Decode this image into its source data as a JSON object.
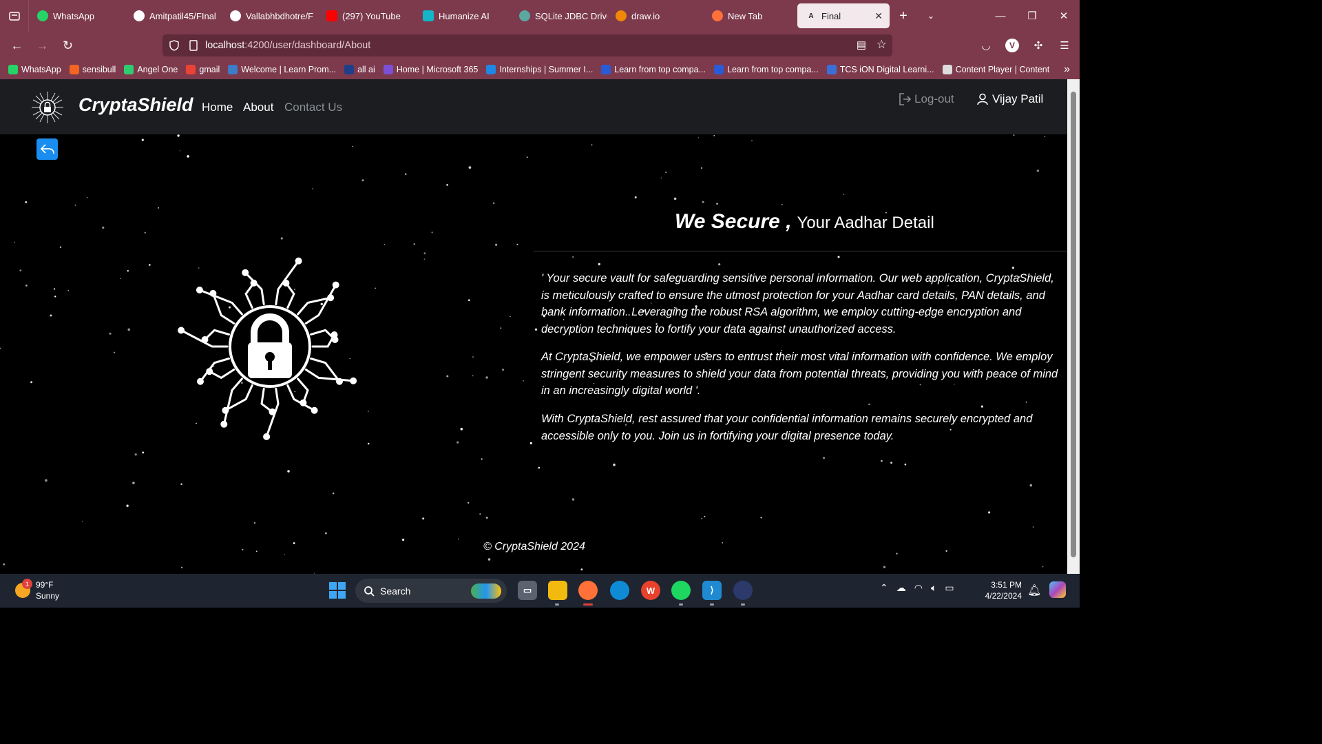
{
  "browser": {
    "tabs": [
      {
        "label": "WhatsApp",
        "icon": "whatsapp-icon",
        "color": "#25d366"
      },
      {
        "label": "Amitpatil45/FInal",
        "icon": "github-icon",
        "color": "#ffffff"
      },
      {
        "label": "Vallabhbdhotre/F",
        "icon": "github-icon",
        "color": "#ffffff"
      },
      {
        "label": "(297) YouTube",
        "icon": "youtube-icon",
        "color": "#ff0000"
      },
      {
        "label": "Humanize AI",
        "icon": "humanize-icon",
        "color": "#13b5c8"
      },
      {
        "label": "SQLite JDBC Drive",
        "icon": "sqlite-icon",
        "color": "#5ba8a0"
      },
      {
        "label": "draw.io",
        "icon": "drawio-icon",
        "color": "#f08705"
      },
      {
        "label": "New Tab",
        "icon": "firefox-icon",
        "color": "#ff7139"
      }
    ],
    "active_tab": {
      "label": "Final",
      "icon": "angular-icon"
    },
    "url_host": "localhost",
    "url_path": ":4200/user/dashboard/About",
    "bookmarks": [
      {
        "label": "WhatsApp",
        "color": "#25d366"
      },
      {
        "label": "sensibull",
        "color": "#f26522"
      },
      {
        "label": "Angel One",
        "color": "#2ecc71"
      },
      {
        "label": "gmail",
        "color": "#ea4335"
      },
      {
        "label": "Welcome | Learn Prom...",
        "color": "#3d7cc9"
      },
      {
        "label": "all ai",
        "color": "#1f3f8c"
      },
      {
        "label": "Home | Microsoft 365",
        "color": "#7b4fd6"
      },
      {
        "label": "Internships | Summer I...",
        "color": "#1e88e5"
      },
      {
        "label": "Learn from top compa...",
        "color": "#2a5bd7"
      },
      {
        "label": "Learn from top compa...",
        "color": "#2a5bd7"
      },
      {
        "label": "TCS iON Digital Learni...",
        "color": "#3b6fd8"
      },
      {
        "label": "Content Player | Content",
        "color": "#dddddd"
      }
    ]
  },
  "app": {
    "brand": "CryptaShield",
    "nav": {
      "home": "Home",
      "about": "About",
      "contact": "Contact Us"
    },
    "logout": "Log-out",
    "user": "Vijay Patil",
    "headline_bold": "We Secure ,",
    "headline_rest": "Your Aadhar Detail",
    "paragraphs": [
      "' Your secure vault for safeguarding sensitive personal information. Our web application, CryptaShield, is meticulously crafted to ensure the utmost protection for your Aadhar card details, PAN details, and bank information. Leveraging the robust RSA algorithm, we employ cutting-edge encryption and decryption techniques to fortify your data against unauthorized access.",
      "At CryptaShield, we empower users to entrust their most vital information with confidence. We employ stringent security measures to shield your data from potential threats, providing you with peace of mind in an increasingly digital world '.",
      "With CryptaShield, rest assured that your confidential information remains securely encrypted and accessible only to you. Join us in fortifying your digital presence today."
    ],
    "footer": "© CryptaShield 2024"
  },
  "taskbar": {
    "weather_temp": "99°F",
    "weather_desc": "Sunny",
    "weather_badge": "1",
    "search_label": "Search",
    "time": "3:51 PM",
    "date": "4/22/2024"
  }
}
